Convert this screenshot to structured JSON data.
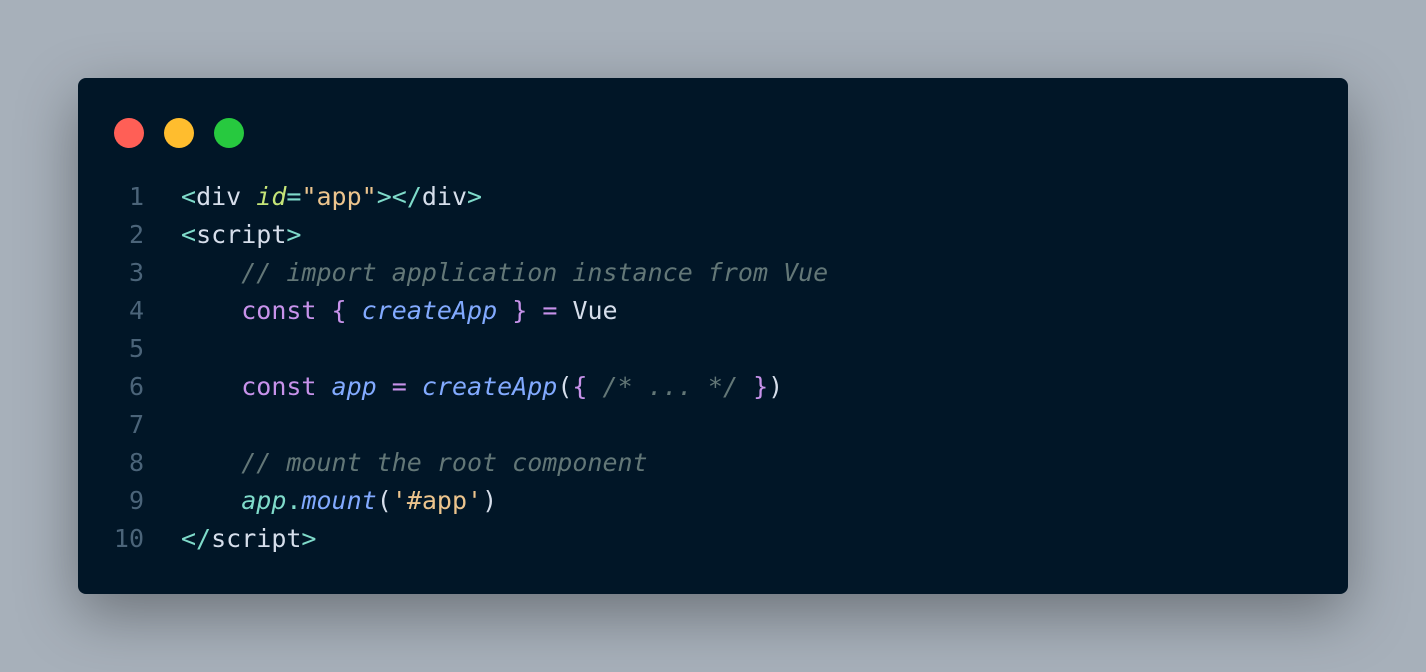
{
  "window": {
    "dots": [
      "close",
      "minimize",
      "maximize"
    ],
    "colors": {
      "background": "#011627",
      "red": "#ff5f56",
      "yellow": "#ffbd2e",
      "green": "#27c93f"
    }
  },
  "code": {
    "lines": [
      {
        "n": "1",
        "tokens": [
          {
            "t": "<",
            "c": "punct"
          },
          {
            "t": "div",
            "c": "tag"
          },
          {
            "t": " ",
            "c": "plain"
          },
          {
            "t": "id",
            "c": "attr"
          },
          {
            "t": "=",
            "c": "punct"
          },
          {
            "t": "\"app\"",
            "c": "str"
          },
          {
            "t": "></",
            "c": "punct"
          },
          {
            "t": "div",
            "c": "tag"
          },
          {
            "t": ">",
            "c": "punct"
          }
        ]
      },
      {
        "n": "2",
        "tokens": [
          {
            "t": "<",
            "c": "punct"
          },
          {
            "t": "script",
            "c": "tag"
          },
          {
            "t": ">",
            "c": "punct"
          }
        ]
      },
      {
        "n": "3",
        "tokens": [
          {
            "t": "    ",
            "c": "plain"
          },
          {
            "t": "// import application instance from Vue",
            "c": "comment"
          }
        ]
      },
      {
        "n": "4",
        "tokens": [
          {
            "t": "    ",
            "c": "plain"
          },
          {
            "t": "const",
            "c": "kw"
          },
          {
            "t": " ",
            "c": "plain"
          },
          {
            "t": "{",
            "c": "brace"
          },
          {
            "t": " ",
            "c": "plain"
          },
          {
            "t": "createApp",
            "c": "fn"
          },
          {
            "t": " ",
            "c": "plain"
          },
          {
            "t": "}",
            "c": "brace"
          },
          {
            "t": " ",
            "c": "plain"
          },
          {
            "t": "=",
            "c": "kw"
          },
          {
            "t": " Vue",
            "c": "plain"
          }
        ]
      },
      {
        "n": "5",
        "tokens": []
      },
      {
        "n": "6",
        "tokens": [
          {
            "t": "    ",
            "c": "plain"
          },
          {
            "t": "const",
            "c": "kw"
          },
          {
            "t": " ",
            "c": "plain"
          },
          {
            "t": "app",
            "c": "var"
          },
          {
            "t": " ",
            "c": "plain"
          },
          {
            "t": "=",
            "c": "kw"
          },
          {
            "t": " ",
            "c": "plain"
          },
          {
            "t": "createApp",
            "c": "fn"
          },
          {
            "t": "(",
            "c": "plain"
          },
          {
            "t": "{",
            "c": "brace"
          },
          {
            "t": " ",
            "c": "plain"
          },
          {
            "t": "/* ... */",
            "c": "comment"
          },
          {
            "t": " ",
            "c": "plain"
          },
          {
            "t": "}",
            "c": "brace"
          },
          {
            "t": ")",
            "c": "plain"
          }
        ]
      },
      {
        "n": "7",
        "tokens": []
      },
      {
        "n": "8",
        "tokens": [
          {
            "t": "    ",
            "c": "plain"
          },
          {
            "t": "// mount the root component",
            "c": "comment"
          }
        ]
      },
      {
        "n": "9",
        "tokens": [
          {
            "t": "    ",
            "c": "plain"
          },
          {
            "t": "app",
            "c": "obj"
          },
          {
            "t": ".",
            "c": "punct"
          },
          {
            "t": "mount",
            "c": "fn"
          },
          {
            "t": "(",
            "c": "plain"
          },
          {
            "t": "'#app'",
            "c": "str"
          },
          {
            "t": ")",
            "c": "plain"
          }
        ]
      },
      {
        "n": "10",
        "tokens": [
          {
            "t": "</",
            "c": "punct"
          },
          {
            "t": "script",
            "c": "tag"
          },
          {
            "t": ">",
            "c": "punct"
          }
        ]
      }
    ]
  }
}
